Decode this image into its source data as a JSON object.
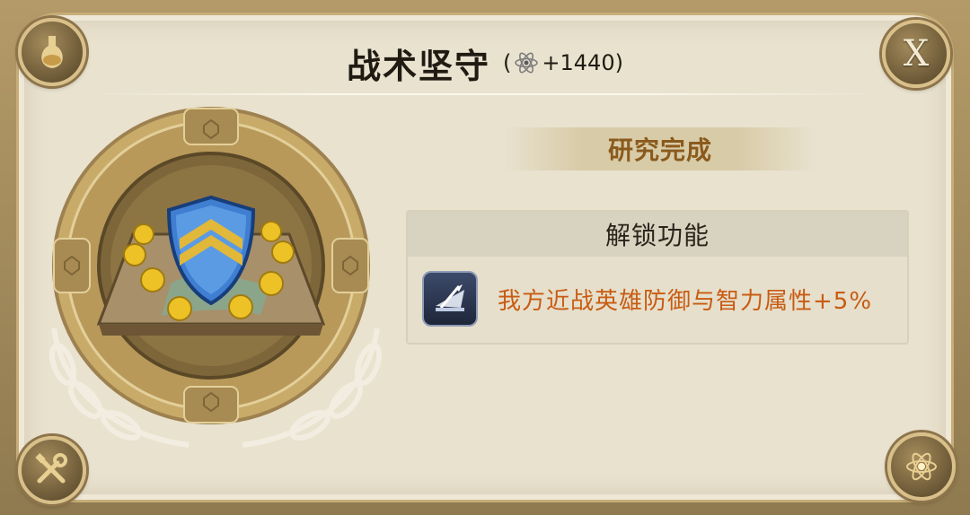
{
  "research": {
    "title": "战术坚守",
    "cost_open": "(",
    "cost_value": "+1440",
    "cost_close": ")",
    "status": "研究完成"
  },
  "unlock": {
    "header": "解锁功能",
    "effect": "我方近战英雄防御与智力属性+5%"
  },
  "buttons": {
    "close_label": "X"
  },
  "icons": {
    "top_left": "flask-icon",
    "top_right": "close-icon",
    "bottom_left": "tools-icon",
    "bottom_right": "atom-icon",
    "cost": "atom-icon",
    "medal": "shield-medal-icon",
    "skill": "sword-skill-icon"
  },
  "colors": {
    "status_text": "#8a5a1c",
    "effect_text": "#c85c12",
    "panel_bg": "#e9e2cf",
    "gold": "#b8995a"
  }
}
